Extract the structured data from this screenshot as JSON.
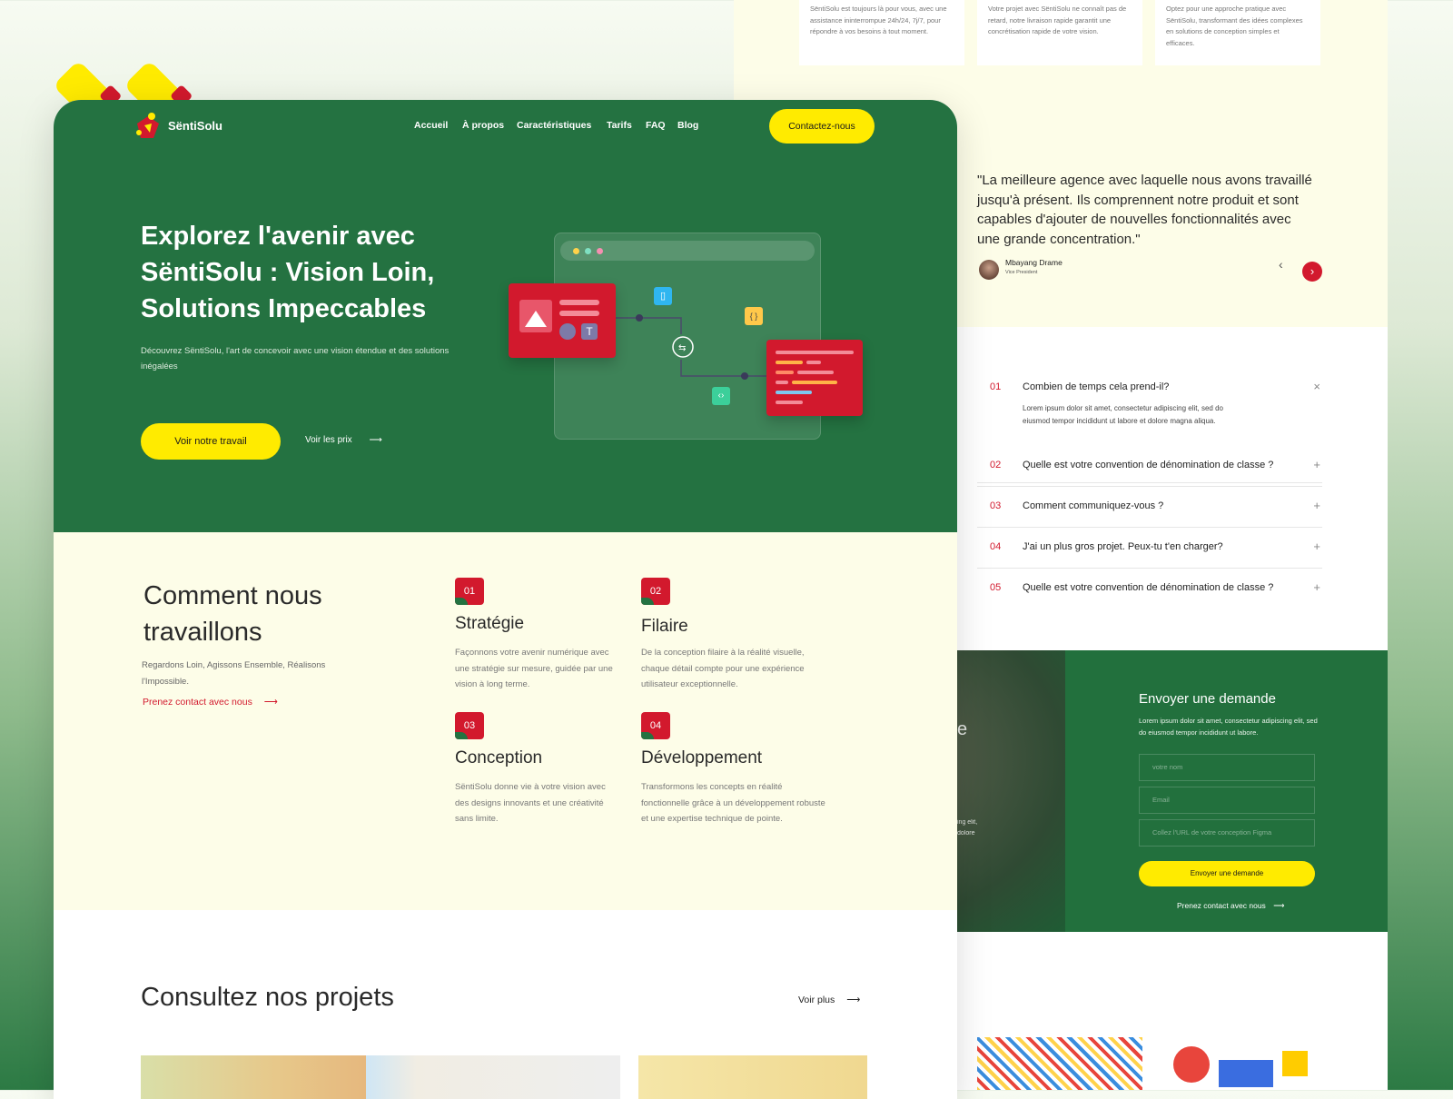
{
  "back": {
    "features": [
      {
        "text": "SëntiSolu est toujours là pour vous, avec une assistance ininterrompue 24h/24, 7j/7, pour répondre à vos besoins à tout moment."
      },
      {
        "text": "Votre projet avec SëntiSolu ne connaît pas de retard, notre livraison rapide garantit une concrétisation rapide de votre vision."
      },
      {
        "text": "Optez pour une approche pratique avec SëntiSolu, transformant des idées complexes en solutions de conception simples et efficaces."
      }
    ],
    "testimonial": {
      "quote": "\"La meilleure agence avec laquelle nous avons travaillé jusqu'à présent. Ils comprennent notre produit et sont capables d'ajouter de nouvelles fonctionnalités avec une grande concentration.\"",
      "author": "Mbayang Drame",
      "role": "Vice President"
    },
    "faq": [
      {
        "num": "01",
        "q": "Combien de temps cela prend-il?",
        "a": "Lorem ipsum dolor sit amet, consectetur adipiscing elit, sed do eiusmod tempor incididunt ut labore et dolore magna aliqua.",
        "toggle": "×"
      },
      {
        "num": "02",
        "q": "Quelle est votre convention de dénomination de classe ?",
        "toggle": "+"
      },
      {
        "num": "03",
        "q": "Comment communiquez-vous ?",
        "toggle": "+"
      },
      {
        "num": "04",
        "q": "J'ai un plus gros projet. Peux-tu t'en charger?",
        "toggle": "+"
      },
      {
        "num": "05",
        "q": "Quelle est votre convention de dénomination de classe ?",
        "toggle": "+"
      }
    ],
    "contact": {
      "photo_fragment_1": "e",
      "photo_fragment_2": "ing elit,",
      "photo_fragment_3": "dolore",
      "title": "Envoyer une demande",
      "text": "Lorem ipsum dolor sit amet, consectetur adipiscing elit, sed do eiusmod tempor incididunt ut labore.",
      "name_placeholder": "votre nom",
      "email_placeholder": "Email",
      "figma_placeholder": "Collez l'URL de votre conception Figma",
      "submit": "Envoyer une demande",
      "link": "Prenez contact avec nous"
    }
  },
  "header": {
    "logo": "SëntiSolu",
    "nav": [
      "Accueil",
      "À propos",
      "Caractéristiques",
      "Tarifs",
      "FAQ",
      "Blog"
    ],
    "cta": "Contactez-nous"
  },
  "hero": {
    "title": "Explorez l'avenir avec SëntiSolu : Vision Loin, Solutions Impeccables",
    "subtitle": "Découvrez SëntiSolu, l'art de concevoir avec une vision étendue et des solutions inégalées",
    "primary_btn": "Voir notre travail",
    "secondary_link": "Voir les prix",
    "illustration_t": "T",
    "illustration_braces": "{ }"
  },
  "how": {
    "title": "Comment nous travaillons",
    "text": "Regardons Loin, Agissons Ensemble, Réalisons l'Impossible.",
    "link": "Prenez contact avec nous",
    "steps": [
      {
        "num": "01",
        "title": "Stratégie",
        "text": "Façonnons votre avenir numérique avec une stratégie sur mesure, guidée par une vision à long terme."
      },
      {
        "num": "02",
        "title": "Filaire",
        "text": "De la conception filaire à la réalité visuelle, chaque détail compte pour une expérience utilisateur exceptionnelle."
      },
      {
        "num": "03",
        "title": "Conception",
        "text": "SëntiSolu donne vie à votre vision avec des designs innovants et une créativité sans limite."
      },
      {
        "num": "04",
        "title": "Développement",
        "text": "Transformons les concepts en réalité fonctionnelle grâce à un développement robuste et une expertise technique de pointe."
      }
    ]
  },
  "projects": {
    "title": "Consultez nos projets",
    "more": "Voir plus"
  },
  "colors": {
    "green": "#247241",
    "yellow": "#ffeb00",
    "red": "#d2192d",
    "cream": "#fdfde8"
  }
}
